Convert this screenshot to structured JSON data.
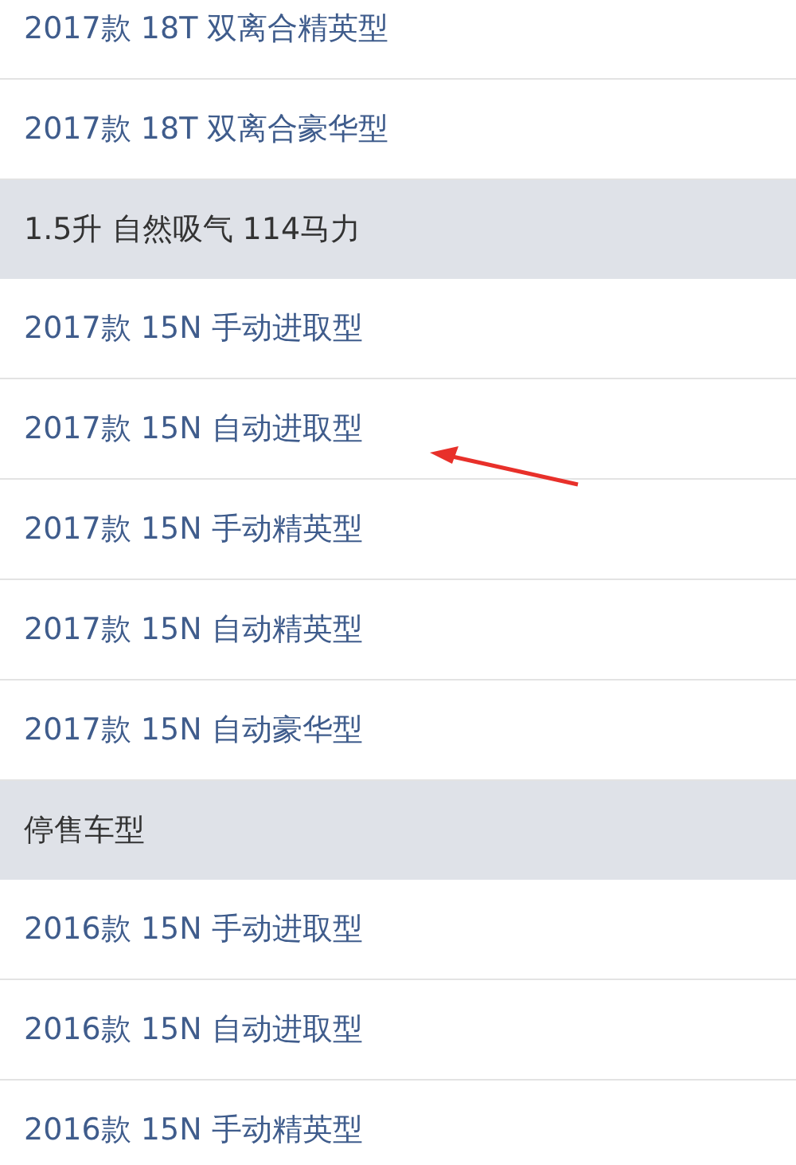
{
  "sections": [
    {
      "items": [
        "2017款 18T 双离合精英型",
        "2017款 18T 双离合豪华型"
      ]
    },
    {
      "header": "1.5升 自然吸气 114马力",
      "items": [
        "2017款 15N 手动进取型",
        "2017款 15N 自动进取型",
        "2017款 15N 手动精英型",
        "2017款 15N 自动精英型",
        "2017款 15N 自动豪华型"
      ]
    },
    {
      "header": "停售车型",
      "items": [
        "2016款 15N 手动进取型",
        "2016款 15N 自动进取型",
        "2016款 15N 手动精英型"
      ]
    }
  ]
}
